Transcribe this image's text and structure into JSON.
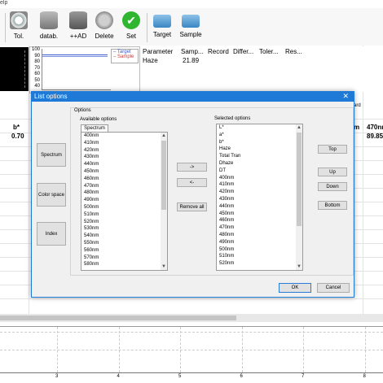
{
  "menu": {
    "help_fragment": "elp"
  },
  "toolbar": {
    "buttons": [
      {
        "label": "Tol.",
        "icon": "tolerance-icon"
      },
      {
        "label": "datab.",
        "icon": "database-icon"
      },
      {
        "label": "++AD",
        "icon": "add-database-icon"
      },
      {
        "label": "Delete",
        "icon": "recycle-delete-icon"
      },
      {
        "label": "Set",
        "icon": "checkmark-icon"
      },
      {
        "label": "Target",
        "icon": "target-instrument-icon"
      },
      {
        "label": "Sample",
        "icon": "sample-instrument-icon"
      }
    ]
  },
  "spectrum_chart": {
    "y_ticks": [
      "100",
      "90",
      "80",
      "70",
      "60",
      "50",
      "40"
    ],
    "legend": [
      "Target",
      "Sample"
    ],
    "colors": {
      "target": "#3a5bd0",
      "sample": "#d03a3a"
    }
  },
  "param_table": {
    "headers": [
      "Parameter",
      "Samp...",
      "Record",
      "Differ...",
      "Toler...",
      "Res..."
    ],
    "row": [
      "Haze",
      "21.89"
    ]
  },
  "background_values": {
    "left_label": "b*",
    "left_value": "0.70",
    "right_col1_label": "m",
    "right_col2_label": "470nm",
    "right_value": "89.85",
    "partial_header": "ard"
  },
  "bottom_axis": {
    "ticks": [
      "3",
      "4",
      "5",
      "6",
      "7",
      "8"
    ]
  },
  "dialog": {
    "title": "List options",
    "group_label": "Options",
    "side_buttons": [
      "Spectrum",
      "Color space",
      "Index"
    ],
    "available": {
      "caption": "Available options",
      "tab": "Spectrum",
      "items": [
        "400nm",
        "410nm",
        "420nm",
        "430nm",
        "440nm",
        "450nm",
        "460nm",
        "470nm",
        "480nm",
        "490nm",
        "500nm",
        "510nm",
        "520nm",
        "530nm",
        "540nm",
        "550nm",
        "560nm",
        "570nm",
        "580nm"
      ]
    },
    "move_buttons": {
      "add": "->",
      "remove": "<-",
      "remove_all": "Remove all"
    },
    "selected": {
      "caption": "Selected options",
      "items": [
        "L*",
        "a*",
        "b*",
        "Haze",
        "Total Tran",
        "Dhaze",
        "DT",
        "400nm",
        "410nm",
        "420nm",
        "430nm",
        "440nm",
        "450nm",
        "460nm",
        "470nm",
        "480nm",
        "490nm",
        "500nm",
        "510nm",
        "520nm"
      ]
    },
    "order_buttons": {
      "top": "Top",
      "up": "Up",
      "down": "Down",
      "bottom": "Bottom"
    },
    "ok": "OK",
    "cancel": "Cancel",
    "close": "✕"
  }
}
